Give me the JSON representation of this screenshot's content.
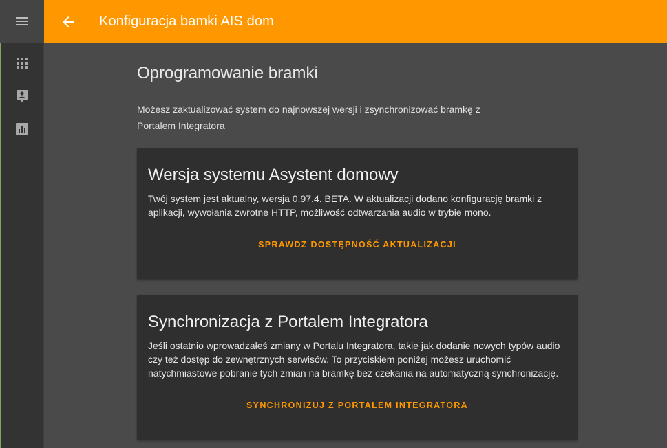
{
  "colors": {
    "accent": "#ff9800",
    "background": "#4a4a4a",
    "sidebar": "#333333",
    "card": "#2f2f2f"
  },
  "header": {
    "title": "Konfiguracja bamki AIS dom",
    "back_icon": "arrow-back-icon",
    "menu_icon": "menu-icon"
  },
  "sidebar": {
    "items": [
      {
        "icon": "apps-grid-icon"
      },
      {
        "icon": "account-box-icon"
      },
      {
        "icon": "chart-bar-icon"
      }
    ]
  },
  "section": {
    "header": "Oprogramowanie bramki",
    "intro": "Możesz zaktualizować system do najnowszej wersji i zsynchronizować bramkę z Portalem Integratora"
  },
  "cards": [
    {
      "title": "Wersja systemu Asystent domowy",
      "text": "Twój system jest aktualny, wersja 0.97.4. BETA. W aktualizacji dodano konfigurację bramki z aplikacji, wywołania zwrotne HTTP, możliwość odtwarzania audio w trybie mono.",
      "action": "Sprawdz dostępność aktualizacji"
    },
    {
      "title": "Synchronizacja z Portalem Integratora",
      "text": "Jeśli ostatnio wprowadzałeś zmiany w Portalu Integratora, takie jak dodanie nowych typów audio czy też dostęp do zewnętrznych serwisów. To przyciskiem poniżej możesz uruchomić natychmiastowe pobranie tych zmian na bramkę bez czekania na automatyczną synchronizację.",
      "action": "Synchronizuj z Portalem Integratora"
    }
  ]
}
